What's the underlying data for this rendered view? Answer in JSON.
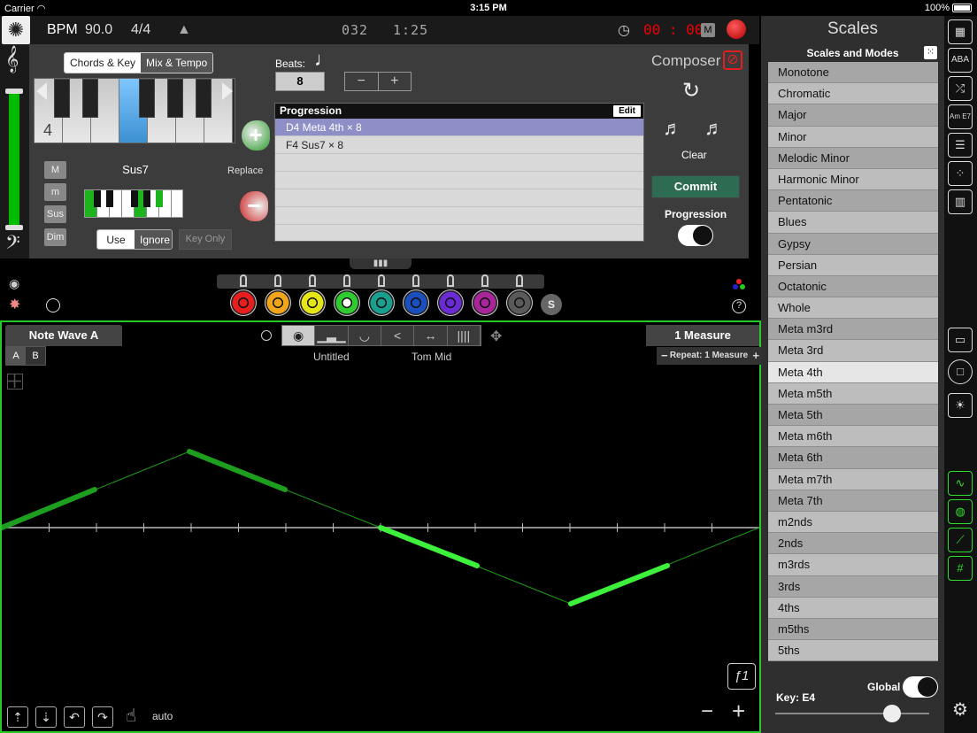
{
  "status": {
    "carrier": "Carrier",
    "time": "3:15 PM",
    "battery": "100%"
  },
  "toolbar": {
    "bpm_label": "BPM",
    "bpm_value": "90.0",
    "time_sig": "4/4",
    "counter": "032",
    "clock": "1:25",
    "rec_time": "00 : 00",
    "m_badge": "M"
  },
  "composer": {
    "tabs": [
      {
        "label": "Chords & Key"
      },
      {
        "label": "Mix & Tempo"
      }
    ],
    "beats_label": "Beats:",
    "beats_value": "8",
    "title": "Composer",
    "octave": "4",
    "chord_buttons": [
      {
        "label": "M"
      },
      {
        "label": "m"
      },
      {
        "label": "Sus"
      },
      {
        "label": "Dim"
      }
    ],
    "chord_name": "Sus7",
    "replace_label": "Replace",
    "use_label": "Use",
    "ignore_label": "Ignore",
    "key_only_label": "Key Only",
    "progression_header": "Progression",
    "edit_label": "Edit",
    "progression_rows": [
      {
        "text": "D4 Meta 4th × 8"
      },
      {
        "text": "F4 Sus7 × 8"
      }
    ],
    "clear_label": "Clear",
    "commit_label": "Commit",
    "progression_toggle_label": "Progression"
  },
  "rings": {
    "colors": [
      "#e81e1e",
      "#f0a51a",
      "#e6e617",
      "#2ecc2e",
      "#1a9e8e",
      "#1b4fbf",
      "#6a2bd6",
      "#a8259a",
      "#5a5a5a"
    ],
    "s_label": "S"
  },
  "wave": {
    "title": "Note Wave A",
    "tab_a": "A",
    "tab_b": "B",
    "name": "Untitled",
    "instrument": "Tom Mid",
    "measure": "1 Measure",
    "repeat": "Repeat: 1 Measure",
    "auto_label": "auto",
    "f_label": "ƒ1"
  },
  "scales": {
    "title": "Scales",
    "subtitle": "Scales and Modes",
    "items": [
      "Monotone",
      "Chromatic",
      "Major",
      "Minor",
      "Melodic Minor",
      "Harmonic Minor",
      "Pentatonic",
      "Blues",
      "Gypsy",
      "Persian",
      "Octatonic",
      "Whole",
      "Meta m3rd",
      "Meta 3rd",
      "Meta 4th",
      "Meta m5th",
      "Meta 5th",
      "Meta m6th",
      "Meta 6th",
      "Meta m7th",
      "Meta 7th",
      "m2nds",
      "2nds",
      "m3rds",
      "3rds",
      "4ths",
      "m5ths",
      "5ths"
    ],
    "selected": "Meta 4th",
    "global_label": "Global",
    "key_label": "Key:  E4"
  },
  "colors": {
    "accent_green": "#28c828",
    "wave_line": "#1e9e1e",
    "wave_line_active": "#3cf03c"
  }
}
